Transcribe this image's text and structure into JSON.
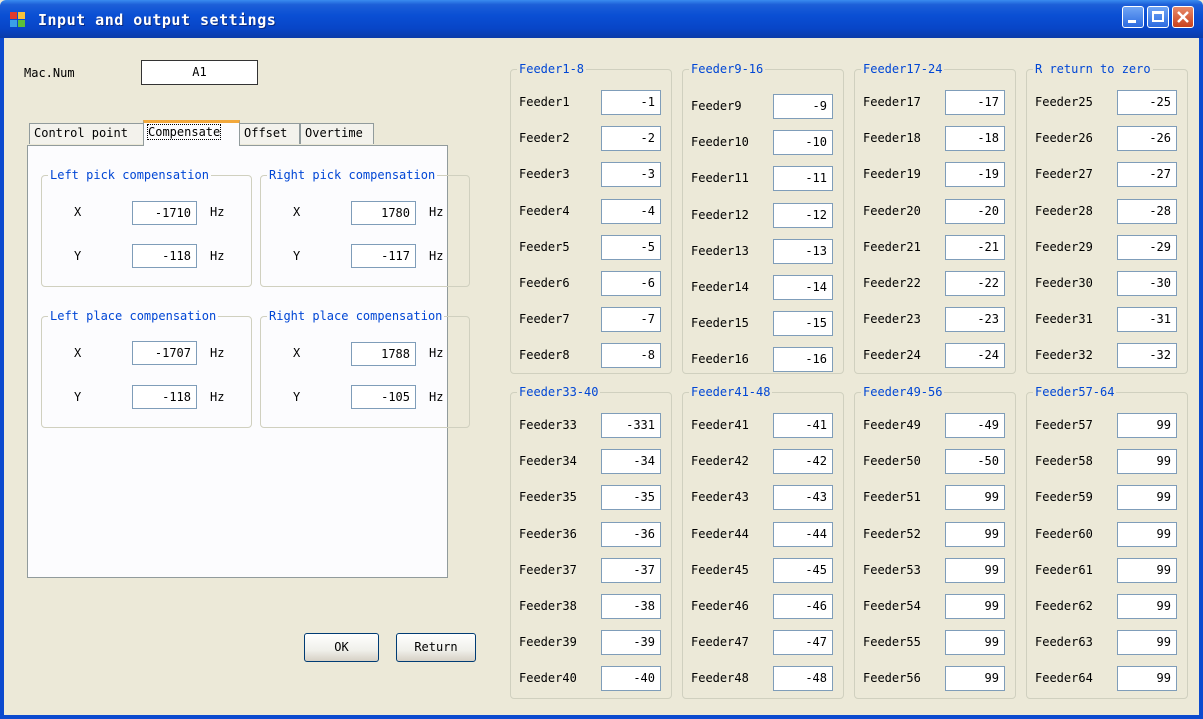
{
  "window": {
    "title": "Input and output settings"
  },
  "mac": {
    "label": "Mac.Num",
    "value": "A1"
  },
  "tabs": [
    "Control point",
    "Compensate",
    "Offset",
    "Overtime"
  ],
  "compensate": {
    "unit": "Hz",
    "x_label": "X",
    "y_label": "Y",
    "left_pick": {
      "title": "Left pick compensation",
      "x": "-1710",
      "y": "-118"
    },
    "right_pick": {
      "title": "Right pick compensation",
      "x": "1780",
      "y": "-117"
    },
    "left_place": {
      "title": "Left place compensation",
      "x": "-1707",
      "y": "-118"
    },
    "right_place": {
      "title": "Right place compensation",
      "x": "1788",
      "y": "-105"
    }
  },
  "buttons": {
    "ok": "OK",
    "return": "Return"
  },
  "feeder_groups": [
    {
      "title": "Feeder1-8",
      "feeders": [
        {
          "label": "Feeder1",
          "value": "-1"
        },
        {
          "label": "Feeder2",
          "value": "-2"
        },
        {
          "label": "Feeder3",
          "value": "-3"
        },
        {
          "label": "Feeder4",
          "value": "-4"
        },
        {
          "label": "Feeder5",
          "value": "-5"
        },
        {
          "label": "Feeder6",
          "value": "-6"
        },
        {
          "label": "Feeder7",
          "value": "-7"
        },
        {
          "label": "Feeder8",
          "value": "-8"
        }
      ]
    },
    {
      "title": "Feeder9-16",
      "feeders": [
        {
          "label": "Feeder9",
          "value": "-9"
        },
        {
          "label": "Feeder10",
          "value": "-10"
        },
        {
          "label": "Feeder11",
          "value": "-11"
        },
        {
          "label": "Feeder12",
          "value": "-12"
        },
        {
          "label": "Feeder13",
          "value": "-13"
        },
        {
          "label": "Feeder14",
          "value": "-14"
        },
        {
          "label": "Feeder15",
          "value": "-15"
        },
        {
          "label": "Feeder16",
          "value": "-16"
        }
      ]
    },
    {
      "title": "Feeder17-24",
      "feeders": [
        {
          "label": "Feeder17",
          "value": "-17"
        },
        {
          "label": "Feeder18",
          "value": "-18"
        },
        {
          "label": "Feeder19",
          "value": "-19"
        },
        {
          "label": "Feeder20",
          "value": "-20"
        },
        {
          "label": "Feeder21",
          "value": "-21"
        },
        {
          "label": "Feeder22",
          "value": "-22"
        },
        {
          "label": "Feeder23",
          "value": "-23"
        },
        {
          "label": "Feeder24",
          "value": "-24"
        }
      ]
    },
    {
      "title": "R return to zero",
      "feeders": [
        {
          "label": "Feeder25",
          "value": "-25"
        },
        {
          "label": "Feeder26",
          "value": "-26"
        },
        {
          "label": "Feeder27",
          "value": "-27"
        },
        {
          "label": "Feeder28",
          "value": "-28"
        },
        {
          "label": "Feeder29",
          "value": "-29"
        },
        {
          "label": "Feeder30",
          "value": "-30"
        },
        {
          "label": "Feeder31",
          "value": "-31"
        },
        {
          "label": "Feeder32",
          "value": "-32"
        }
      ]
    },
    {
      "title": "Feeder33-40",
      "feeders": [
        {
          "label": "Feeder33",
          "value": "-331"
        },
        {
          "label": "Feeder34",
          "value": "-34"
        },
        {
          "label": "Feeder35",
          "value": "-35"
        },
        {
          "label": "Feeder36",
          "value": "-36"
        },
        {
          "label": "Feeder37",
          "value": "-37"
        },
        {
          "label": "Feeder38",
          "value": "-38"
        },
        {
          "label": "Feeder39",
          "value": "-39"
        },
        {
          "label": "Feeder40",
          "value": "-40"
        }
      ]
    },
    {
      "title": "Feeder41-48",
      "feeders": [
        {
          "label": "Feeder41",
          "value": "-41"
        },
        {
          "label": "Feeder42",
          "value": "-42"
        },
        {
          "label": "Feeder43",
          "value": "-43"
        },
        {
          "label": "Feeder44",
          "value": "-44"
        },
        {
          "label": "Feeder45",
          "value": "-45"
        },
        {
          "label": "Feeder46",
          "value": "-46"
        },
        {
          "label": "Feeder47",
          "value": "-47"
        },
        {
          "label": "Feeder48",
          "value": "-48"
        }
      ]
    },
    {
      "title": "Feeder49-56",
      "feeders": [
        {
          "label": "Feeder49",
          "value": "-49"
        },
        {
          "label": "Feeder50",
          "value": "-50"
        },
        {
          "label": "Feeder51",
          "value": "99"
        },
        {
          "label": "Feeder52",
          "value": "99"
        },
        {
          "label": "Feeder53",
          "value": "99"
        },
        {
          "label": "Feeder54",
          "value": "99"
        },
        {
          "label": "Feeder55",
          "value": "99"
        },
        {
          "label": "Feeder56",
          "value": "99"
        }
      ]
    },
    {
      "title": "Feeder57-64",
      "feeders": [
        {
          "label": "Feeder57",
          "value": "99"
        },
        {
          "label": "Feeder58",
          "value": "99"
        },
        {
          "label": "Feeder59",
          "value": "99"
        },
        {
          "label": "Feeder60",
          "value": "99"
        },
        {
          "label": "Feeder61",
          "value": "99"
        },
        {
          "label": "Feeder62",
          "value": "99"
        },
        {
          "label": "Feeder63",
          "value": "99"
        },
        {
          "label": "Feeder64",
          "value": "99"
        }
      ]
    }
  ]
}
